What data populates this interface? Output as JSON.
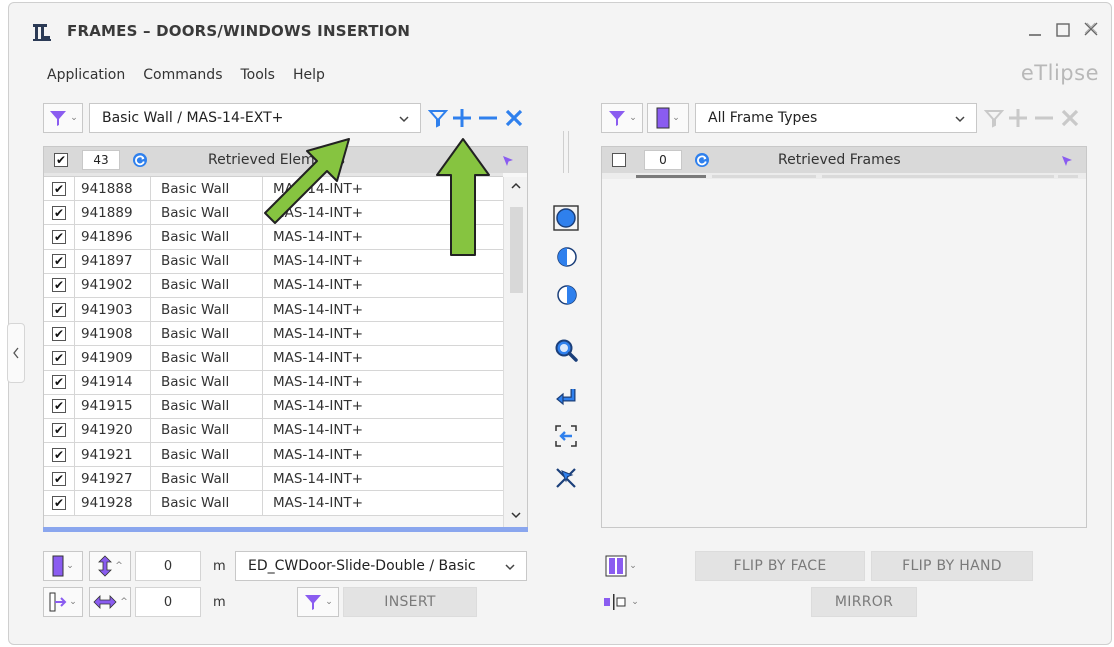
{
  "window": {
    "title": "FRAMES – DOORS/WINDOWS INSERTION",
    "brand": "eTlipse"
  },
  "menu": [
    "Application",
    "Commands",
    "Tools",
    "Help"
  ],
  "left": {
    "filter_value": "Basic Wall / MAS-14-EXT+",
    "count": "43",
    "header_label": "Retrieved Elements",
    "rows": [
      {
        "id": "941888",
        "family": "Basic Wall",
        "type": "MAS-14-INT+",
        "checked": true
      },
      {
        "id": "941889",
        "family": "Basic Wall",
        "type": "MAS-14-INT+",
        "checked": true
      },
      {
        "id": "941896",
        "family": "Basic Wall",
        "type": "MAS-14-INT+",
        "checked": true
      },
      {
        "id": "941897",
        "family": "Basic Wall",
        "type": "MAS-14-INT+",
        "checked": true
      },
      {
        "id": "941902",
        "family": "Basic Wall",
        "type": "MAS-14-INT+",
        "checked": true
      },
      {
        "id": "941903",
        "family": "Basic Wall",
        "type": "MAS-14-INT+",
        "checked": true
      },
      {
        "id": "941908",
        "family": "Basic Wall",
        "type": "MAS-14-INT+",
        "checked": true
      },
      {
        "id": "941909",
        "family": "Basic Wall",
        "type": "MAS-14-INT+",
        "checked": true
      },
      {
        "id": "941914",
        "family": "Basic Wall",
        "type": "MAS-14-INT+",
        "checked": true
      },
      {
        "id": "941915",
        "family": "Basic Wall",
        "type": "MAS-14-INT+",
        "checked": true
      },
      {
        "id": "941920",
        "family": "Basic Wall",
        "type": "MAS-14-INT+",
        "checked": true
      },
      {
        "id": "941921",
        "family": "Basic Wall",
        "type": "MAS-14-INT+",
        "checked": true
      },
      {
        "id": "941927",
        "family": "Basic Wall",
        "type": "MAS-14-INT+",
        "checked": true
      },
      {
        "id": "941928",
        "family": "Basic Wall",
        "type": "MAS-14-INT+",
        "checked": true
      }
    ]
  },
  "right": {
    "filter_value": "All Frame Types",
    "count": "0",
    "header_label": "Retrieved Frames"
  },
  "bottom": {
    "offset_vertical": "0",
    "offset_horizontal": "0",
    "unit": "m",
    "family_type": "ED_CWDoor-Slide-Double / Basic",
    "insert_label": "INSERT",
    "flip_face_label": "FLIP BY FACE",
    "flip_hand_label": "FLIP BY HAND",
    "mirror_label": "MIRROR"
  },
  "colors": {
    "accent_purple": "#8a5cf0",
    "accent_blue": "#2f80ed",
    "arrow_green": "#86c440",
    "progress_blue": "#8aa6ee"
  },
  "icons": {
    "filter": "filter-icon",
    "add": "plus-icon",
    "remove": "minus-icon",
    "clear": "clear-x-icon",
    "refresh": "refresh-icon",
    "pick": "cursor-icon"
  }
}
